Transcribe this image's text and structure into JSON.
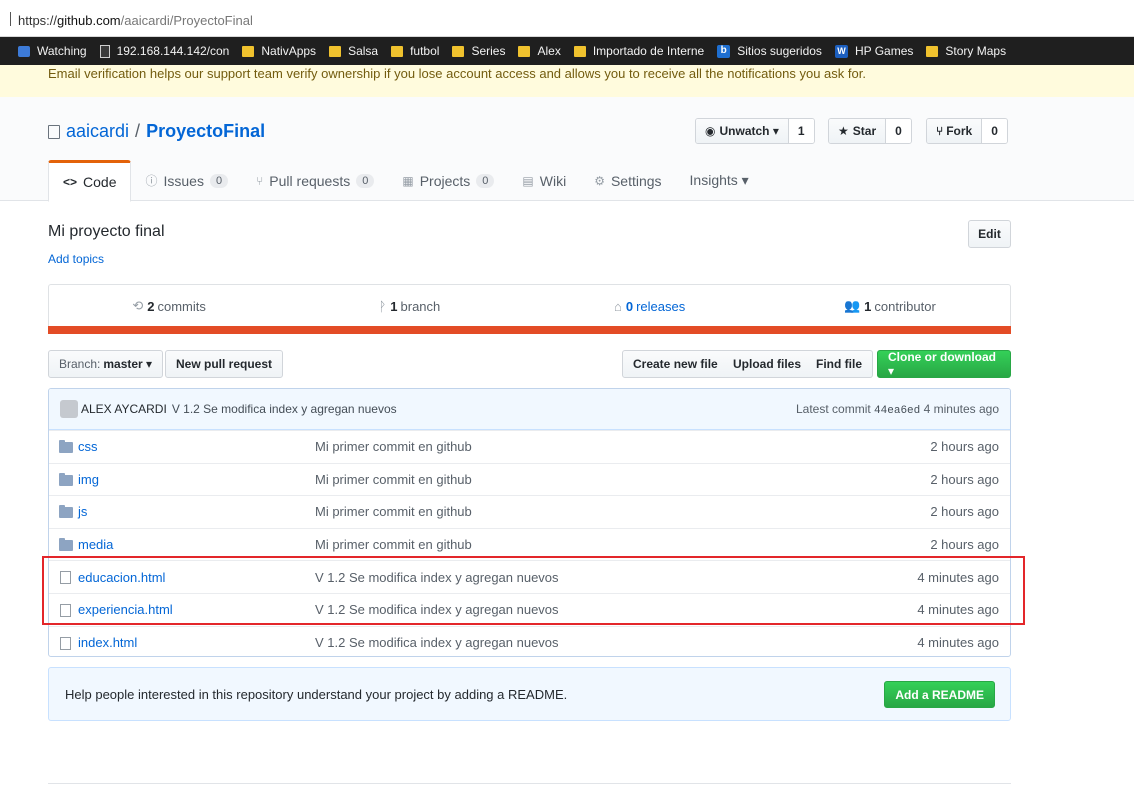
{
  "browser": {
    "url_scheme": "https://",
    "url_host": "github.com",
    "url_path": "/aaicardi/ProyectoFinal"
  },
  "bookmarks": [
    {
      "label": "Watching",
      "icon": "watch-icon"
    },
    {
      "label": "192.168.144.142/con",
      "icon": "page-icon"
    },
    {
      "label": "NativApps",
      "icon": "folder-icon"
    },
    {
      "label": "Salsa",
      "icon": "folder-icon"
    },
    {
      "label": "futbol",
      "icon": "folder-icon"
    },
    {
      "label": "Series",
      "icon": "folder-icon"
    },
    {
      "label": "Alex",
      "icon": "folder-icon"
    },
    {
      "label": "Importado de Interne",
      "icon": "folder-icon"
    },
    {
      "label": "Sitios sugeridos",
      "icon": "bing-icon"
    },
    {
      "label": "HP Games",
      "icon": "hp-icon"
    },
    {
      "label": "Story Maps",
      "icon": "folder-icon"
    }
  ],
  "flash": {
    "text": "Email verification helps our support team verify ownership if you lose account access and allows you to receive all the notifications you ask for."
  },
  "repo": {
    "owner": "aaicardi",
    "separator": "/",
    "name": "ProyectoFinal",
    "description": "Mi proyecto final",
    "add_topics": "Add topics",
    "edit_label": "Edit"
  },
  "actions": {
    "watch_label": "Unwatch ▾",
    "watch_count": "1",
    "star_label": "Star",
    "star_count": "0",
    "fork_label": "Fork",
    "fork_count": "0"
  },
  "tabs": [
    {
      "label": "Code",
      "icon": "<>",
      "counter": null
    },
    {
      "label": "Issues",
      "icon": "ⓘ",
      "counter": "0"
    },
    {
      "label": "Pull requests",
      "icon": "⑂",
      "counter": "0"
    },
    {
      "label": "Projects",
      "icon": "▦",
      "counter": "0"
    },
    {
      "label": "Wiki",
      "icon": "▤",
      "counter": null
    },
    {
      "label": "Settings",
      "icon": "⚙",
      "counter": null
    },
    {
      "label": "Insights ▾",
      "icon": "",
      "counter": null
    }
  ],
  "summary": {
    "commits_num": "2",
    "commits_label": "commits",
    "branch_num": "1",
    "branch_label": "branch",
    "releases_num": "0",
    "releases_label": "releases",
    "contributors_num": "1",
    "contributors_label": "contributor",
    "language_color": "#e34c26"
  },
  "filenav": {
    "branch_prefix": "Branch:",
    "branch_name": "master ▾",
    "new_pr": "New pull request",
    "create_file": "Create new file",
    "upload_files": "Upload files",
    "find_file": "Find file",
    "clone": "Clone or download ▾"
  },
  "latest_commit": {
    "author": "ALEX AYCARDI",
    "message": "V 1.2 Se modifica index y agregan nuevos",
    "prefix": "Latest commit",
    "sha": "44ea6ed",
    "age": "4 minutes ago"
  },
  "files": [
    {
      "name": "css",
      "type": "dir",
      "message": "Mi primer commit en github",
      "age": "2 hours ago"
    },
    {
      "name": "img",
      "type": "dir",
      "message": "Mi primer commit en github",
      "age": "2 hours ago"
    },
    {
      "name": "js",
      "type": "dir",
      "message": "Mi primer commit en github",
      "age": "2 hours ago"
    },
    {
      "name": "media",
      "type": "dir",
      "message": "Mi primer commit en github",
      "age": "2 hours ago"
    },
    {
      "name": "educacion.html",
      "type": "file",
      "message": "V 1.2 Se modifica index y agregan nuevos",
      "age": "4 minutes ago"
    },
    {
      "name": "experiencia.html",
      "type": "file",
      "message": "V 1.2 Se modifica index y agregan nuevos",
      "age": "4 minutes ago"
    },
    {
      "name": "index.html",
      "type": "file",
      "message": "V 1.2 Se modifica index y agregan nuevos",
      "age": "4 minutes ago"
    }
  ],
  "readme": {
    "text": "Help people interested in this repository understand your project by adding a README.",
    "button": "Add a README"
  },
  "colors": {
    "highlight": "#e3262a",
    "accent": "#0366d6",
    "green": "#28a745"
  }
}
